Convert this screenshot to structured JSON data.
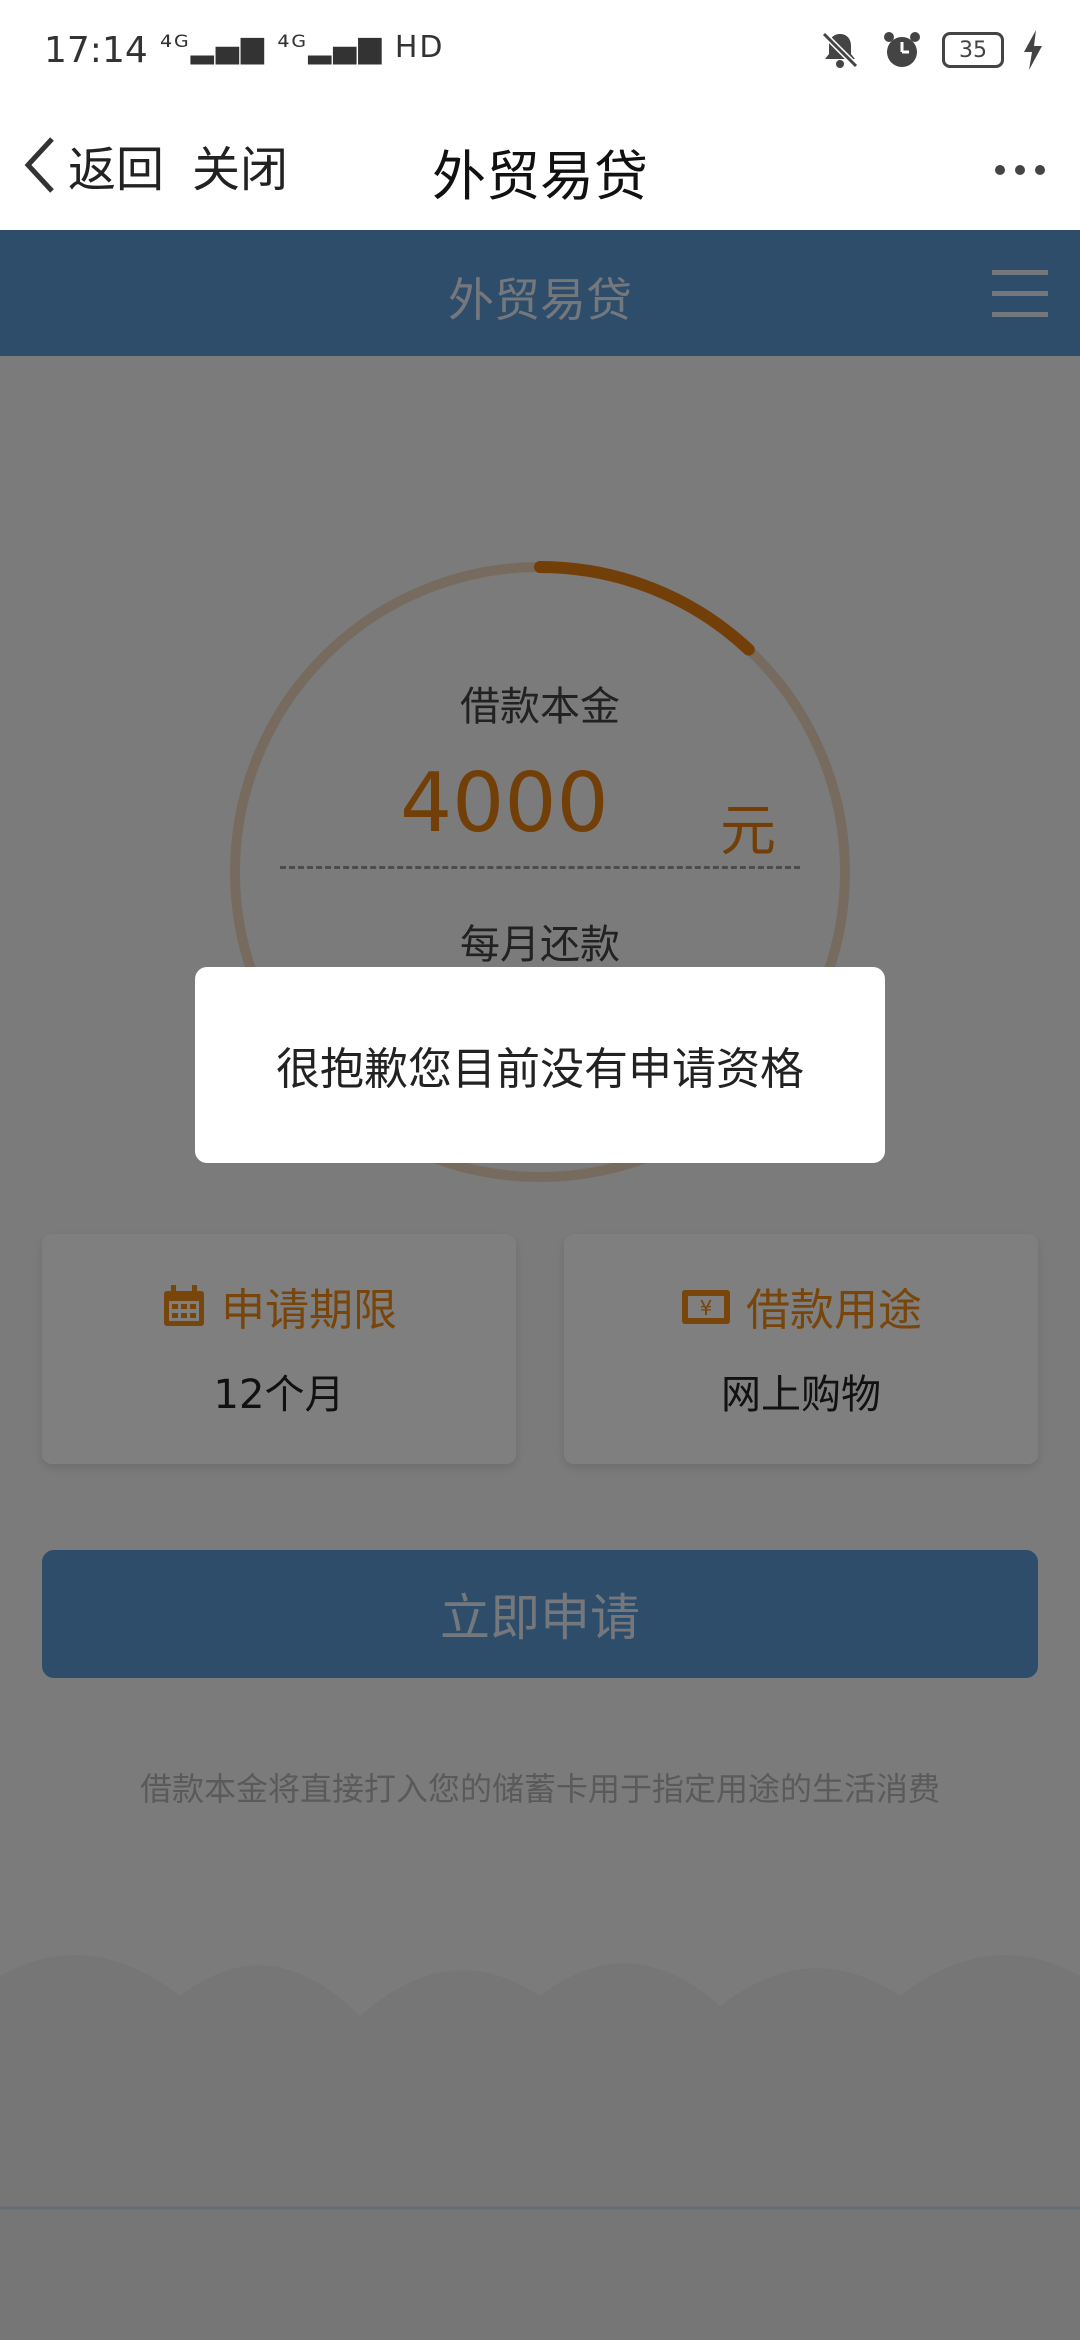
{
  "status_bar": {
    "time": "17:14",
    "signal_text": "⁴ᴳ▂▄▆ ⁴ᴳ▂▄▆ HD",
    "battery": "35",
    "icons": [
      "mute-icon",
      "alarm-icon",
      "battery-icon",
      "charging-icon"
    ]
  },
  "titlebar": {
    "back_label": "返回",
    "close_label": "关闭",
    "title": "外贸易贷",
    "more_icon": "more-dots-icon"
  },
  "app_header": {
    "title": "外贸易贷",
    "menu_icon": "hamburger-menu-icon"
  },
  "loan": {
    "principal_label": "借款本金",
    "principal_amount": "4000",
    "principal_unit": "元",
    "monthly_label": "每月还款",
    "ring_progress_fraction": 0.12
  },
  "cards": {
    "term": {
      "icon": "calendar-icon",
      "title": "申请期限",
      "value": "12个月"
    },
    "purpose": {
      "icon": "money-icon",
      "title": "借款用途",
      "value": "网上购物"
    }
  },
  "apply_button": "立即申请",
  "footnote": "借款本金将直接打入您的储蓄卡用于指定用途的生活消费",
  "dialog": {
    "message": "很抱歉您目前没有申请资格"
  },
  "colors": {
    "brand_blue": "#5d9ad4",
    "accent_orange": "#e67e10",
    "overlay": "rgba(0,0,0,0.5)"
  }
}
